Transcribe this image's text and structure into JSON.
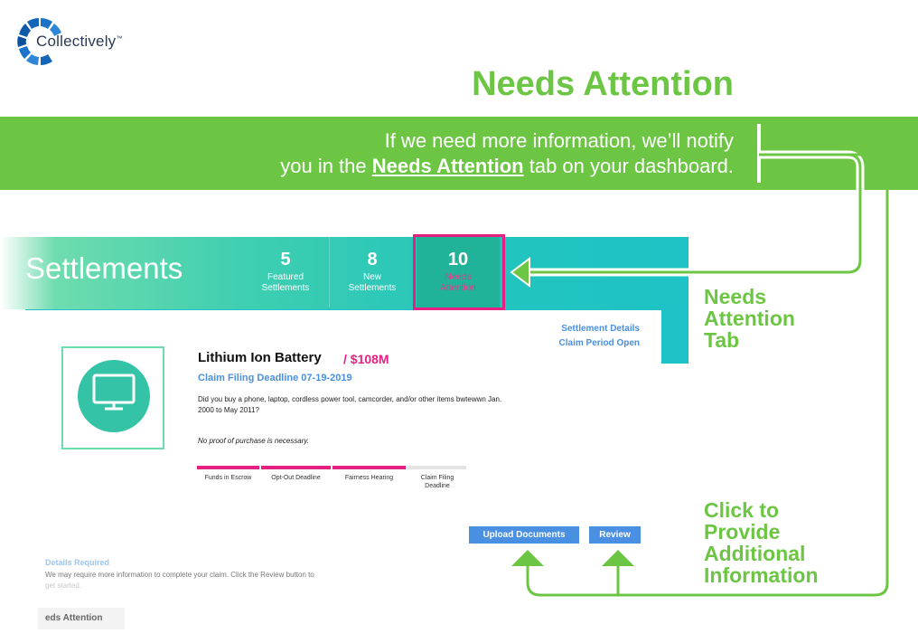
{
  "brand": {
    "name": "Collectively",
    "trademark": "™"
  },
  "headline": "Needs Attention",
  "banner": {
    "line1": "If we need more information, we’ll notify",
    "line2_before": "you in the ",
    "line2_highlight": "Needs Attention",
    "line2_after": " tab on your dashboard."
  },
  "dashboard": {
    "title": "Settlements",
    "stats": [
      {
        "value": "5",
        "label1": "Featured",
        "label2": "Settlements"
      },
      {
        "value": "8",
        "label1": "New",
        "label2": "Settlements"
      },
      {
        "value": "10",
        "label1": "Needs",
        "label2": "Attention"
      }
    ]
  },
  "card": {
    "meta_line1": "Settlement Details",
    "meta_line2": "Claim Period Open",
    "title": "Lithium Ion Battery",
    "amount": "/ $108M",
    "deadline": "Claim Filing Deadline 07-19-2019",
    "description": "Did you buy a phone, laptop, cordless power tool, camcorder, and/or other items bwtewwn Jan. 2000 to May 2011?",
    "note": "No proof of purchase is necessary.",
    "timeline": [
      {
        "label": "Funds in Escrow"
      },
      {
        "label": "Opt-Out Deadline"
      },
      {
        "label": "Fairness Hearing"
      },
      {
        "label": "Claim Filing Deadline"
      }
    ],
    "buttons": {
      "upload": "Upload Documents",
      "review": "Review"
    },
    "details_title": "Details Required",
    "details_text": "We may require more information to complete your claim. Click the Review button to",
    "details_text2": "get started.",
    "tab_label": "eds Attention"
  },
  "callouts": {
    "tab": [
      "Needs",
      "Attention",
      "Tab"
    ],
    "provide": [
      "Click to",
      "Provide",
      "Additional",
      "Information"
    ]
  },
  "colors": {
    "green": "#6cc644",
    "teal": "#1dc3c6",
    "pink": "#e61f83",
    "blue": "#4a90e2"
  },
  "icons": {
    "logo": "collectively-ring-logo",
    "product": "monitor-icon"
  }
}
